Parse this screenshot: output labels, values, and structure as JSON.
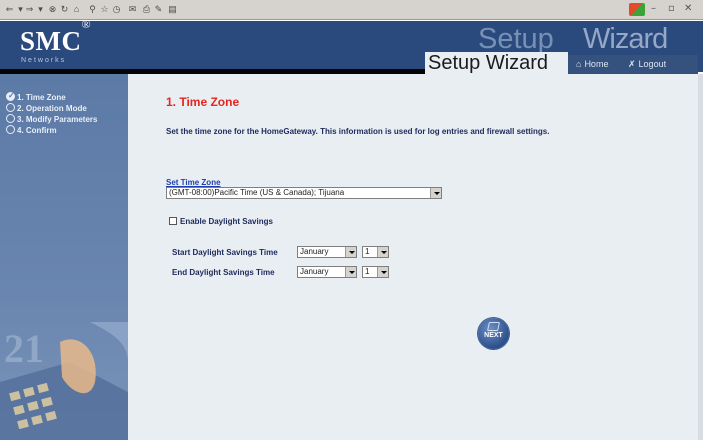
{
  "header": {
    "logo": "SMC",
    "logo_mark": "®",
    "logo_sub": "Networks",
    "ghost_title_a": "Setup",
    "ghost_title_b": "Wizard",
    "title": "Setup Wizard",
    "nav": [
      {
        "label": "Home",
        "icon": "home-icon"
      },
      {
        "label": "Logout",
        "icon": "logout-icon"
      }
    ]
  },
  "sidebar": {
    "steps": [
      {
        "label": "1. Time Zone",
        "done": true
      },
      {
        "label": "2. Operation Mode",
        "done": false
      },
      {
        "label": "3. Modify Parameters",
        "done": false
      },
      {
        "label": "4. Confirm",
        "done": false
      }
    ],
    "art_number": "21"
  },
  "main": {
    "title": "1. Time Zone",
    "description": "Set the time zone for the HomeGateway. This information is used for log entries and firewall settings.",
    "timezone_label": "Set Time Zone",
    "timezone_value": "(GMT-08:00)Pacific Time (US & Canada); Tijuana",
    "daylight_label": "Enable Daylight Savings",
    "daylight_checked": false,
    "start_label": "Start Daylight Savings Time",
    "start_month": "January",
    "start_day": "1",
    "end_label": "End Daylight Savings Time",
    "end_month": "January",
    "end_day": "1",
    "next_label": "NEXT"
  },
  "colors": {
    "header_bg": "#2a4a7e",
    "content_bg": "#e9eef3",
    "title_red": "#e8241c",
    "sidebar_bg": "#6986b0"
  }
}
